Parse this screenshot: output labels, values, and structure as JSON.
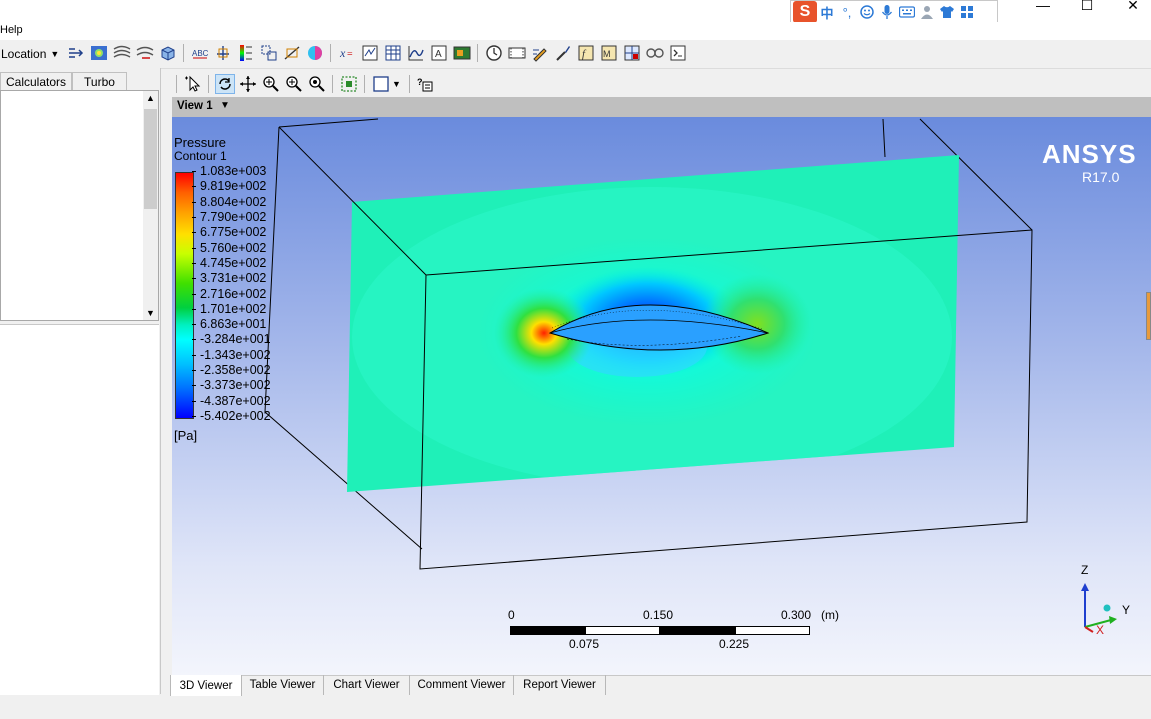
{
  "window": {
    "menu_help": "Help",
    "minimize_label": "—",
    "maximize_label": "☐",
    "close_label": "✕"
  },
  "ime": {
    "logo": "S",
    "lang": "中",
    "punct": "°,",
    "emoji_icon": "smiley-icon",
    "mic_icon": "microphone-icon",
    "keyboard_icon": "keyboard-icon",
    "user_icon": "person-icon",
    "shirt_icon": "shirt-icon",
    "grid_icon": "grid-icon"
  },
  "toolbar": {
    "location_label": "Location"
  },
  "left_panel": {
    "tabs": [
      "Calculators",
      "Turbo"
    ]
  },
  "viewer": {
    "view_label": "View 1",
    "brand": "ANSYS",
    "version": "R17.0"
  },
  "legend": {
    "variable": "Pressure",
    "name": "Contour 1",
    "unit": "[Pa]",
    "values": [
      "1.083e+003",
      "9.819e+002",
      "8.804e+002",
      "7.790e+002",
      "6.775e+002",
      "5.760e+002",
      "4.745e+002",
      "3.731e+002",
      "2.716e+002",
      "1.701e+002",
      "6.863e+001",
      "-3.284e+001",
      "-1.343e+002",
      "-2.358e+002",
      "-3.373e+002",
      "-4.387e+002",
      "-5.402e+002"
    ],
    "colors": {
      "max": "#ff0000",
      "orange": "#ff8000",
      "yellow": "#ffff00",
      "green": "#00d000",
      "cyan": "#00ffff",
      "blue": "#0060ff",
      "min": "#0000ff"
    }
  },
  "scale": {
    "top_labels": [
      "0",
      "0.150",
      "0.300"
    ],
    "unit": "(m)",
    "bottom_labels": [
      "0.075",
      "0.225"
    ]
  },
  "axes": {
    "z": "Z",
    "y": "Y",
    "x": "X"
  },
  "bottom_tabs": [
    "3D Viewer",
    "Table Viewer",
    "Chart Viewer",
    "Comment Viewer",
    "Report Viewer"
  ]
}
